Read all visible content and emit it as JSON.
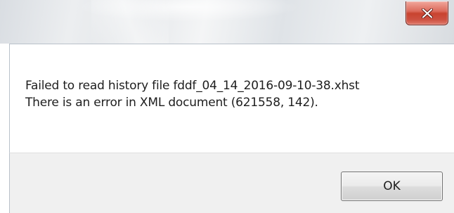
{
  "dialog": {
    "close_icon": "close-icon",
    "message_lines": [
      "Failed to read history file fddf_04_14_2016-09-10-38.xhst",
      "There is an error in XML document (621558, 142)."
    ],
    "ok_label": "OK"
  },
  "colors": {
    "close_button": "#c8432f",
    "footer_background": "#f0f0f0",
    "text": "#1e1e1e"
  }
}
